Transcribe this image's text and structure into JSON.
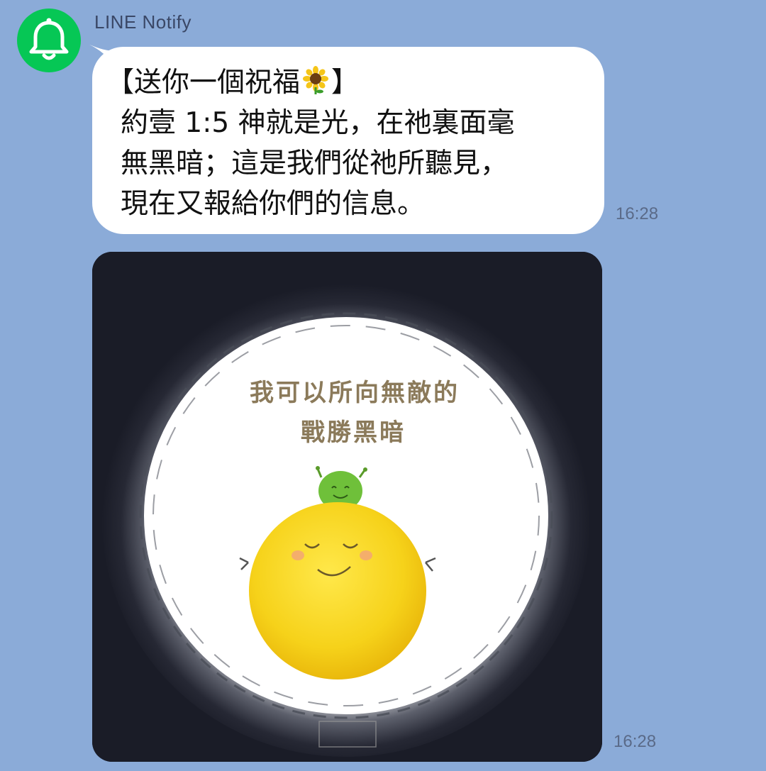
{
  "chat": {
    "sender": {
      "name": "LINE Notify",
      "avatar_icon": "bell-icon",
      "avatar_color": "#06c755"
    },
    "messages": [
      {
        "type": "text",
        "lines": [
          "【送你一個祝福",
          "】",
          "約壹 1:5 神就是光，在祂裏面毫",
          "無黑暗；這是我們從祂所聽見，",
          "現在又報給你們的信息。"
        ],
        "emoji": "sunflower",
        "time": "16:28"
      },
      {
        "type": "image",
        "image_text": [
          "我可以所向無敵的",
          "戰勝黑暗"
        ],
        "time": "16:28"
      }
    ]
  },
  "colors": {
    "background": "#8babd8",
    "bubble": "#ffffff",
    "brand": "#06c755"
  }
}
